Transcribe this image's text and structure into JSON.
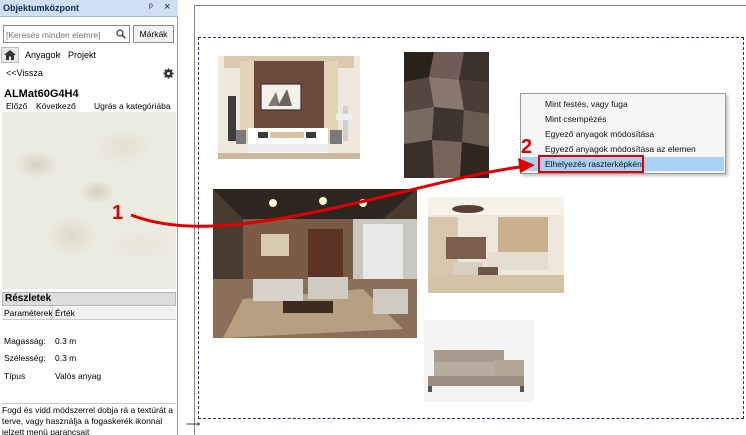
{
  "panel": {
    "title": "Objektumközpont",
    "pin_glyph": "ᵖ",
    "close_glyph": "×",
    "search_placeholder": "[Keresés minden elemre]",
    "brands_button": "Márkák",
    "breadcrumb": {
      "item1": "Anyagok",
      "separator": "›",
      "item2": "Projekt"
    },
    "back_link": "<<Vissza",
    "material_name": "ALMat60G4H4",
    "nav": {
      "prev": "Előző",
      "next": "Következő",
      "jump": "Ugrás a kategóriába"
    },
    "details": {
      "header": "Részletek",
      "col_param": "Paraméterek",
      "col_value": "Érték",
      "rows": [
        {
          "key": "Magasság:",
          "value": "0.3 m"
        },
        {
          "key": "Szélesség:",
          "value": "0.3 m"
        },
        {
          "key": "Típus",
          "value": "Valós anyag"
        }
      ]
    },
    "hint": "Fogd és vidd módszerrel dobja rá a textúrát a terve, vagy használja a fogaskerék ikonnal jelzett menü parancsait"
  },
  "context_menu": {
    "items": [
      "Mint festés, vagy fuga",
      "Mint csempézés",
      "Egyező anyagok módosítása",
      "Egyező anyagok módosítása az elemen",
      "Elhelyezés raszterképként"
    ],
    "selected_index": 4
  },
  "annotations": {
    "step1": "1",
    "step2": "2"
  },
  "colors": {
    "accent_red": "#e00000",
    "menu_highlight": "#a9d0f5",
    "title_bar": "#cfe0f3",
    "dash_border": "#1a2a8a"
  }
}
